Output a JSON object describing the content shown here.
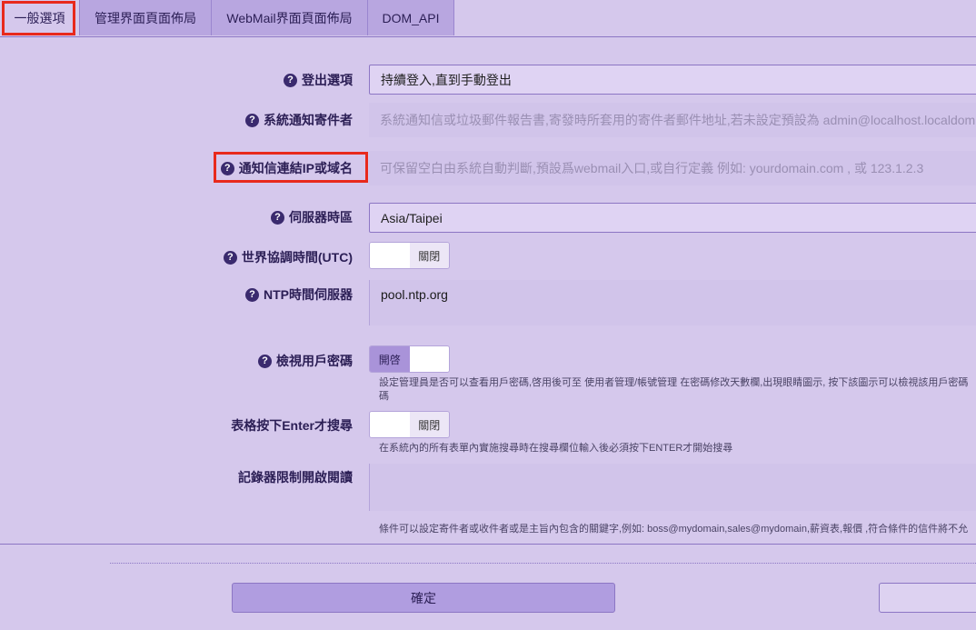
{
  "tabs": [
    {
      "label": "一般選項",
      "active": true
    },
    {
      "label": "管理界面頁面佈局",
      "active": false
    },
    {
      "label": "WebMail界面頁面佈局",
      "active": false
    },
    {
      "label": "DOM_API",
      "active": false
    }
  ],
  "rows": {
    "logout": {
      "label": "登出選項",
      "value": "持續登入,直到手動登出"
    },
    "notify_sender": {
      "label": "系統通知寄件者",
      "placeholder": "系統通知信或垃圾郵件報告書,寄發時所套用的寄件者郵件地址,若未設定預設為 admin@localhost.localdom"
    },
    "notify_link": {
      "label": "通知信連結IP或域名",
      "placeholder": "可保留空白由系統自動判斷,預設爲webmail入口,或自行定義 例如: yourdomain.com , 或 123.1.2.3"
    },
    "timezone": {
      "label": "伺服器時區",
      "value": "Asia/Taipei"
    },
    "utc": {
      "label": "世界協調時間(UTC)",
      "state": "關閉"
    },
    "ntp": {
      "label": "NTP時間伺服器",
      "value": "pool.ntp.org"
    },
    "view_password": {
      "label": "檢視用戶密碼",
      "state": "開啓",
      "hint_line1": "設定管理員是否可以查看用戶密碼,啓用後可至 使用者管理/帳號管理 在密碼修改天數欄,出現眼睛圖示, 按下該圖示可以檢視該用戶密碼",
      "hint_line2": "碼"
    },
    "enter_search": {
      "label": "表格按下Enter才搜尋",
      "state": "關閉",
      "hint": "在系統內的所有表單內實施搜尋時在搜尋欄位輸入後必須按下ENTER才開始搜尋"
    },
    "recorder": {
      "label": "記錄器限制開啟閱讀",
      "hint": "條件可以設定寄件者或收件者或是主旨內包含的關鍵字,例如: boss@mydomain,sales@mydomain,薪資表,報價 ,符合條件的信件將不允"
    }
  },
  "help_icon_glyph": "?",
  "buttons": {
    "ok": "確定"
  },
  "colors": {
    "highlight": "#e8291c",
    "accent": "#b09de0",
    "background": "#d5c8ec"
  }
}
